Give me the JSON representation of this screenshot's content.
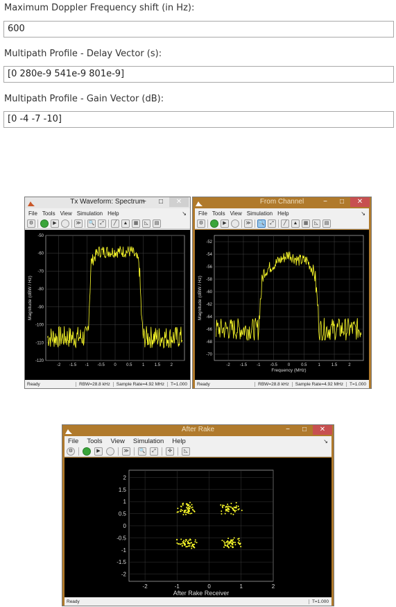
{
  "params": {
    "doppler": {
      "label": "Maximum Doppler Frequency shift (in Hz):",
      "value": "600"
    },
    "delay": {
      "label": "Multipath Profile - Delay Vector (s):",
      "value": "[0 280e-9 541e-9 801e-9]"
    },
    "gain": {
      "label": "Multipath Profile - Gain Vector (dB):",
      "value": "[0 -4 -7 -10]"
    }
  },
  "scopes": {
    "tx": {
      "title": "Tx Waveform: Spectrum",
      "menu": [
        "File",
        "Tools",
        "View",
        "Simulation",
        "Help"
      ],
      "status": {
        "ready": "Ready",
        "rbw": "RBW=28.8 kHz",
        "rate": "Sample Rate=4.92 MHz",
        "time": "T=1.000"
      },
      "ylabel": "Magnitude (dBW / Hz)",
      "xlabel": "",
      "colors": {
        "frame": "#e6e6e6",
        "trace": "#ffff2a"
      }
    },
    "channel": {
      "title": "From Channel",
      "menu": [
        "File",
        "Tools",
        "View",
        "Simulation",
        "Help"
      ],
      "status": {
        "ready": "Ready",
        "rbw": "RBW=28.8 kHz",
        "rate": "Sample Rate=4.92 MHz",
        "time": "T=1.000"
      },
      "ylabel": "Magnitude (dBW / Hz)",
      "xlabel": "Frequency (MHz)",
      "colors": {
        "frame": "#b07a2c",
        "trace": "#ffff2a"
      }
    },
    "rake": {
      "title": "After Rake",
      "menu": [
        "File",
        "Tools",
        "View",
        "Simulation",
        "Help"
      ],
      "status": {
        "ready": "Ready",
        "time": "T=1.000"
      },
      "xlabel": "After Rake Receiver",
      "colors": {
        "frame": "#b07a2c",
        "trace": "#ffff2a"
      }
    }
  },
  "chart_data": [
    {
      "type": "line",
      "title": "Tx Waveform: Spectrum",
      "ylabel": "Magnitude (dBW / Hz)",
      "xlabel": "",
      "xlim": [
        -2.46,
        2.46
      ],
      "ylim": [
        -120,
        -50
      ],
      "xticks": [
        "-2",
        "-1.5",
        "-1",
        "-0.5",
        "0",
        "0.5",
        "1",
        "1.5",
        "2"
      ],
      "yticks": [
        "-50",
        "-60",
        "-70",
        "-80",
        "-90",
        "-100",
        "-110",
        "-120"
      ],
      "x": [
        -2.4,
        -1.0,
        -0.95,
        -0.85,
        -0.6,
        0,
        0.6,
        0.85,
        0.95,
        1.0,
        2.4
      ],
      "values": [
        -107,
        -107,
        -100,
        -65,
        -59,
        -59,
        -59,
        -65,
        -100,
        -107,
        -107
      ],
      "grid": true
    },
    {
      "type": "line",
      "title": "From Channel",
      "ylabel": "Magnitude (dBW / Hz)",
      "xlabel": "Frequency (MHz)",
      "xlim": [
        -2.46,
        2.46
      ],
      "ylim": [
        -71,
        -51
      ],
      "xticks": [
        "-2",
        "-1.5",
        "-1",
        "-0.5",
        "0",
        "0.5",
        "1",
        "1.5",
        "2"
      ],
      "yticks": [
        "-52",
        "-54",
        "-56",
        "-58",
        "-60",
        "-62",
        "-64",
        "-66",
        "-68",
        "-70"
      ],
      "x": [
        -2.4,
        -1.0,
        -0.95,
        -0.85,
        -0.6,
        -0.3,
        0,
        0.3,
        0.6,
        0.85,
        0.95,
        1.0,
        2.4
      ],
      "values": [
        -66,
        -66,
        -62,
        -57,
        -56,
        -55,
        -54,
        -55,
        -55,
        -57,
        -62,
        -66,
        -66
      ],
      "grid": true
    },
    {
      "type": "scatter",
      "title": "After Rake",
      "xlabel": "After Rake Receiver",
      "xlim": [
        -2.5,
        2.0
      ],
      "ylim": [
        -2.3,
        2.3
      ],
      "xticks": [
        "-2",
        "-1",
        "0",
        "1",
        "2"
      ],
      "yticks": [
        "2",
        "1.5",
        "1",
        "0.5",
        "0",
        "-0.5",
        "-1",
        "-1.5",
        "-2"
      ],
      "clusters": [
        {
          "x": -0.7,
          "y": 0.7
        },
        {
          "x": 0.7,
          "y": 0.7
        },
        {
          "x": -0.7,
          "y": -0.7
        },
        {
          "x": 0.7,
          "y": -0.7
        }
      ],
      "grid": true
    }
  ]
}
